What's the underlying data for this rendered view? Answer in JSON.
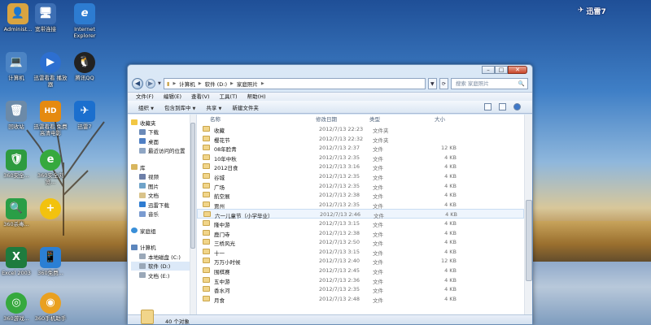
{
  "desktop": {
    "icons": [
      {
        "label": "Administ...",
        "color": "#d9a441",
        "glyph": "👤"
      },
      {
        "label": "宽带连接",
        "color": "#3d6fb4",
        "glyph": "🖥"
      },
      {
        "label": "Internet Explorer",
        "color": "#2d7cd1",
        "glyph": "e"
      },
      {
        "label": "计算机",
        "color": "#4c84c4",
        "glyph": "💻"
      },
      {
        "label": "迅雷看看 播放器",
        "color": "#2d6fd0",
        "glyph": "▶"
      },
      {
        "label": "腾讯QQ",
        "color": "#222222",
        "glyph": "🐧"
      },
      {
        "label": "回收站",
        "color": "#6c8aa8",
        "glyph": "🗑"
      },
      {
        "label": "迅雷看看 免费高清电影",
        "color": "#e58a10",
        "glyph": "HD"
      },
      {
        "label": "迅雷7",
        "color": "#1b6fce",
        "glyph": "✈"
      },
      {
        "label": "360安全...",
        "color": "#2e9b3f",
        "glyph": "🛡"
      },
      {
        "label": "360安全浏览...",
        "color": "#36a93e",
        "glyph": "e"
      },
      {
        "label": "360杀毒...",
        "color": "#2a9e46",
        "glyph": "🔍"
      },
      {
        "label": "",
        "color": "#f2c20e",
        "glyph": "+"
      },
      {
        "label": "Excel 2003",
        "color": "#1e7b3e",
        "glyph": "X"
      },
      {
        "label": "360免费...",
        "color": "#2b7fd4",
        "glyph": "📱"
      },
      {
        "label": "360游戏...",
        "color": "#36a93e",
        "glyph": "◎"
      },
      {
        "label": "360手机助手",
        "color": "#e9a020",
        "glyph": "◉"
      }
    ],
    "xunlei_brand": "迅雷7"
  },
  "window": {
    "address": {
      "computer": "计算机",
      "drive": "软件 (D:)",
      "folder": "家庭照片"
    },
    "search_placeholder": "搜索 家庭照片",
    "menu": [
      "文件(F)",
      "编辑(E)",
      "查看(V)",
      "工具(T)",
      "帮助(H)"
    ],
    "toolbar": {
      "organize": "组织",
      "include": "包含到库中",
      "share": "共享",
      "new_folder": "新建文件夹"
    },
    "nav": {
      "favorites": "收藏夹",
      "downloads": "下载",
      "desktop": "桌面",
      "recent": "最近访问的位置",
      "libraries": "库",
      "videos": "视频",
      "pictures": "图片",
      "documents": "文档",
      "xunlei": "迅雷下载",
      "music": "音乐",
      "homegroup": "家庭组",
      "computer": "计算机",
      "local_c": "本地磁盘 (C:)",
      "soft_d": "软件 (D:)",
      "doc_e": "文档 (E:)"
    },
    "columns": {
      "name": "名称",
      "date": "修改日期",
      "type": "类型",
      "size": "大小"
    },
    "files": [
      {
        "name": "收藏",
        "date": "2012/7/13 22:23",
        "type": "文件夹",
        "size": ""
      },
      {
        "name": "樱花节",
        "date": "2012/7/13 22:32",
        "type": "文件夹",
        "size": ""
      },
      {
        "name": "08年脸青",
        "date": "2012/7/13 2:37",
        "type": "文件",
        "size": "12 KB"
      },
      {
        "name": "10年中秋",
        "date": "2012/7/13 2:35",
        "type": "文件",
        "size": "4 KB"
      },
      {
        "name": "2012日食",
        "date": "2012/7/13 3:16",
        "type": "文件",
        "size": "4 KB"
      },
      {
        "name": "谷城",
        "date": "2012/7/13 2:35",
        "type": "文件",
        "size": "4 KB"
      },
      {
        "name": "广场",
        "date": "2012/7/13 2:35",
        "type": "文件",
        "size": "4 KB"
      },
      {
        "name": "航空展",
        "date": "2012/7/13 2:38",
        "type": "文件",
        "size": "4 KB"
      },
      {
        "name": "贾州",
        "date": "2012/7/13 2:35",
        "type": "文件",
        "size": "4 KB"
      },
      {
        "name": "六一儿童节（小学毕业）",
        "date": "2012/7/13 2:46",
        "type": "文件",
        "size": "4 KB"
      },
      {
        "name": "隆中游",
        "date": "2012/7/13 3:15",
        "type": "文件",
        "size": "4 KB"
      },
      {
        "name": "鹿门寺",
        "date": "2012/7/13 2:38",
        "type": "文件",
        "size": "4 KB"
      },
      {
        "name": "三桥风光",
        "date": "2012/7/13 2:50",
        "type": "文件",
        "size": "4 KB"
      },
      {
        "name": "十一",
        "date": "2012/7/13 3:15",
        "type": "文件",
        "size": "4 KB"
      },
      {
        "name": "万万小时候",
        "date": "2012/7/13 2:40",
        "type": "文件",
        "size": "12 KB"
      },
      {
        "name": "围棋赛",
        "date": "2012/7/13 2:45",
        "type": "文件",
        "size": "4 KB"
      },
      {
        "name": "五中游",
        "date": "2012/7/13 2:36",
        "type": "文件",
        "size": "4 KB"
      },
      {
        "name": "香水河",
        "date": "2012/7/13 2:35",
        "type": "文件",
        "size": "4 KB"
      },
      {
        "name": "月食",
        "date": "2012/7/13 2:48",
        "type": "文件",
        "size": "4 KB"
      }
    ],
    "status": "40 个对象"
  }
}
